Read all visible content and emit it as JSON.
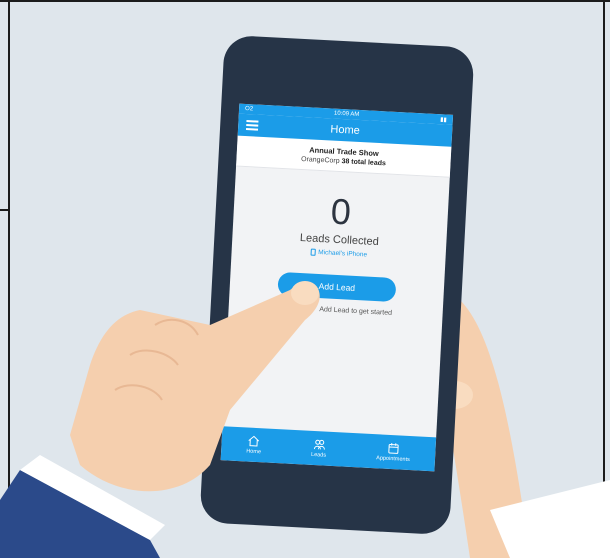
{
  "status": {
    "carrier": "O2",
    "time": "10:09 AM"
  },
  "header": {
    "title": "Home"
  },
  "event": {
    "name": "Annual Trade Show",
    "company": "OrangeCorp",
    "total_leads": "38 total leads"
  },
  "counter": {
    "value": "0",
    "label": "Leads Collected",
    "device": "Michael's iPhone"
  },
  "actions": {
    "add_lead_label": "Add Lead",
    "hint": "Add Lead to get started"
  },
  "tabs": [
    {
      "label": "Home",
      "icon": "home-icon"
    },
    {
      "label": "Leads",
      "icon": "people-icon"
    },
    {
      "label": "Appointments",
      "icon": "calendar-icon"
    }
  ],
  "colors": {
    "accent": "#1b9ce8",
    "phone_body": "#263447",
    "background": "#dfe6ec",
    "skin": "#f5cfae"
  }
}
